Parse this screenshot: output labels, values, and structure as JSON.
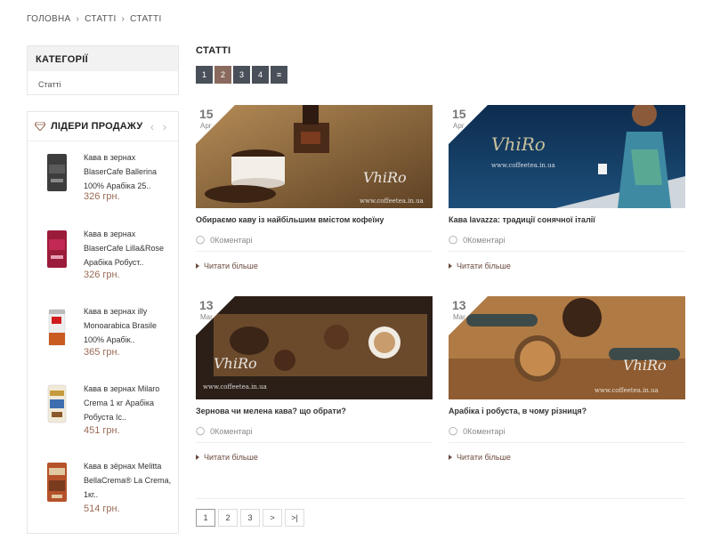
{
  "breadcrumb": [
    "ГОЛОВНА",
    "СТАТТІ",
    "СТАТТІ"
  ],
  "categories": {
    "title": "КАТЕГОРІЇ",
    "items": [
      "Статті"
    ]
  },
  "leaders": {
    "title": "ЛІДЕРИ ПРОДАЖУ",
    "products": [
      {
        "name": "Кава в зернах BlaserCafe Ballerina 100% Арабіка 25..",
        "price": "326 грн."
      },
      {
        "name": "Кава в зернах BlaserCafe Lilla&Rose Арабіка Робуст..",
        "price": "326 грн."
      },
      {
        "name": "Кава в зернах illy Monoarabica Brasile 100% Арабік..",
        "price": "365 грн."
      },
      {
        "name": "Кава в зернах Milaro Crema 1 кг Арабіка Робуста Іс..",
        "price": "451 грн."
      },
      {
        "name": "Кава в зёрнах Melitta BellaCrema® La Crema, 1кг..",
        "price": "514 грн."
      }
    ]
  },
  "main": {
    "title": "СТАТТІ",
    "top_pages": [
      "1",
      "2",
      "3",
      "4"
    ],
    "articles": [
      {
        "day": "15",
        "month": "Apr",
        "title": "Обираємо каву із найбільшим вмістом кофеїну",
        "comments": "0Коментарі",
        "more": "Читати більше"
      },
      {
        "day": "15",
        "month": "Apr",
        "title": "Кава lavazza: традиції сонячної італії",
        "comments": "0Коментарі",
        "more": "Читати більше"
      },
      {
        "day": "13",
        "month": "Mar",
        "title": "Зернова чи мелена кава? що обрати?",
        "comments": "0Коментарі",
        "more": "Читати більше"
      },
      {
        "day": "13",
        "month": "Mar",
        "title": "Арабіка і робуста, в чому різниця?",
        "comments": "0Коментарі",
        "more": "Читати більше"
      }
    ],
    "watermark": {
      "brand": "VhiRo",
      "site": "www.coffeetea.in.ua"
    },
    "bottom_pages": [
      "1",
      "2",
      "3",
      ">",
      ">|"
    ]
  },
  "colors": {
    "accent": "#8a6a5e",
    "pager": "#4a5059",
    "price": "#9a6a56",
    "link": "#6b4a3e"
  }
}
